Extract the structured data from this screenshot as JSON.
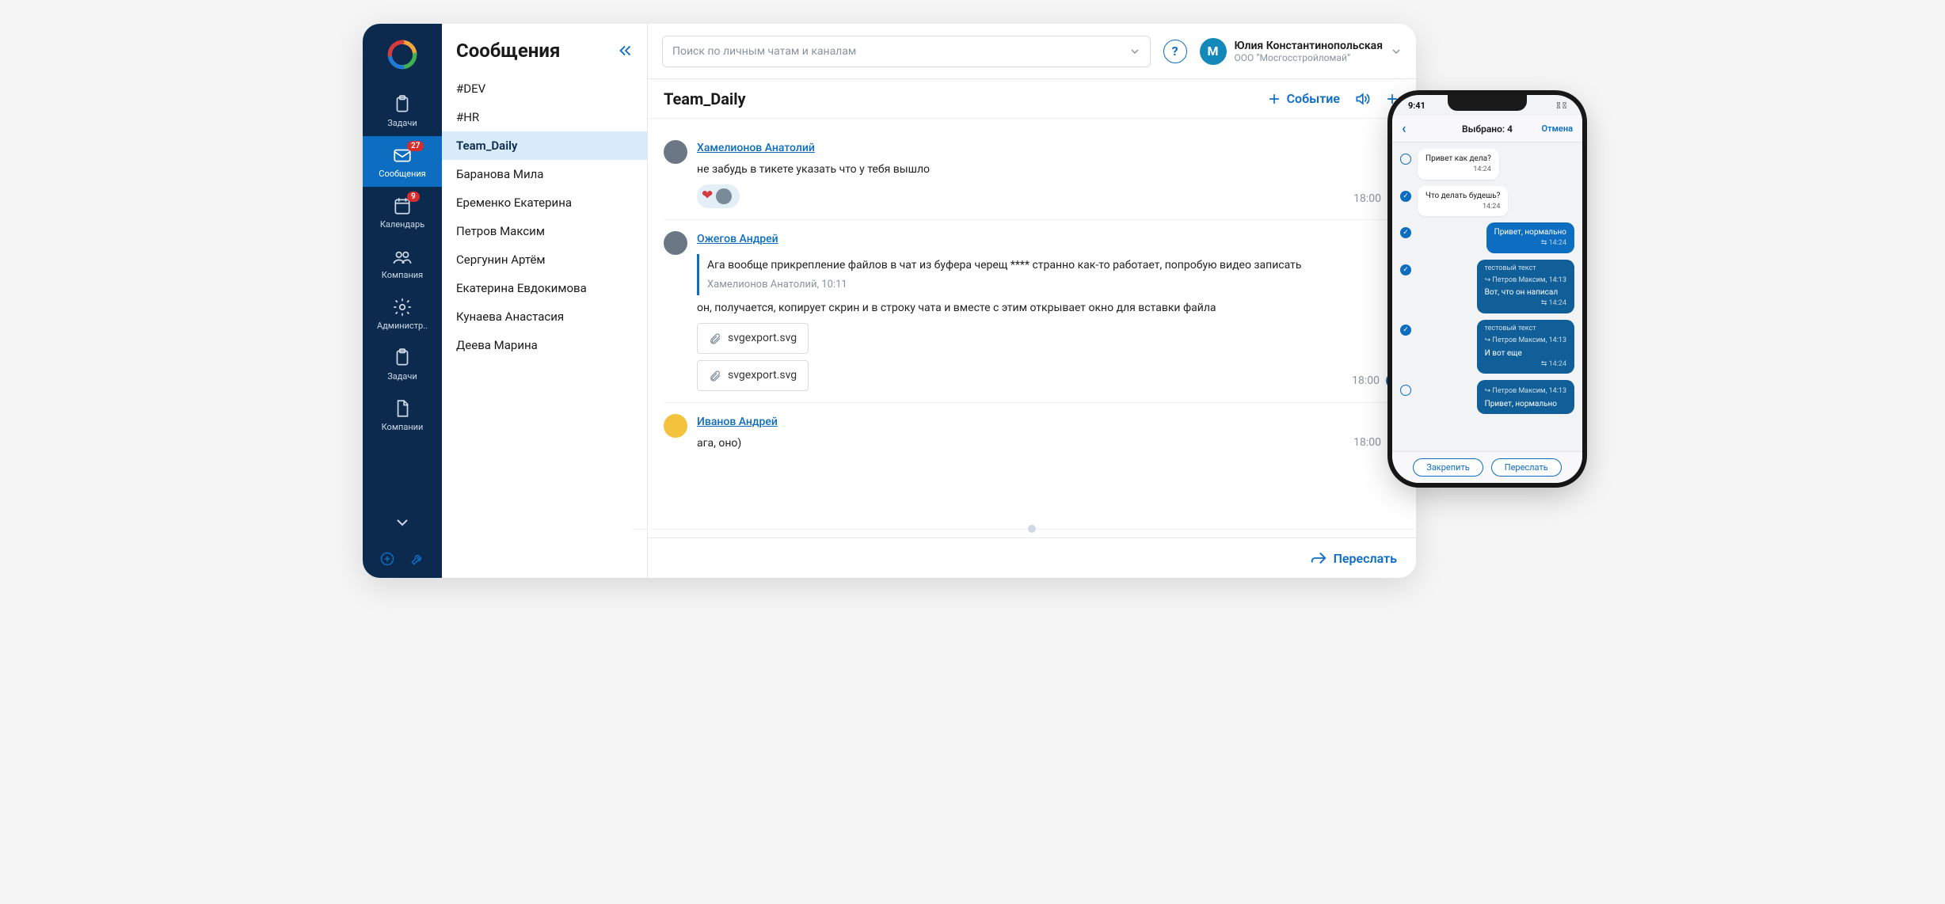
{
  "rail": {
    "items": [
      {
        "label": "Задачи",
        "badge": null
      },
      {
        "label": "Сообщения",
        "badge": "27"
      },
      {
        "label": "Календарь",
        "badge": "9"
      },
      {
        "label": "Компания",
        "badge": null
      },
      {
        "label": "Администр..",
        "badge": null
      },
      {
        "label": "Задачи",
        "badge": null
      },
      {
        "label": "Компании",
        "badge": null
      }
    ]
  },
  "channels": {
    "title": "Сообщения",
    "items": [
      "#DEV",
      "#HR",
      "Team_Daily",
      "Баранова Мила",
      "Еременко Екатерина",
      "Петров Максим",
      "Сергунин Артём",
      "Екатерина Евдокимова",
      "Кунаева Анастасия",
      "Деева Марина"
    ],
    "active": "Team_Daily"
  },
  "search": {
    "placeholder": "Поиск по личным чатам и каналам"
  },
  "user": {
    "initial": "М",
    "name": "Юлия Константинопольская",
    "org": "ООО “Мосгосстройломай”"
  },
  "chat": {
    "title": "Team_Daily",
    "actions": {
      "event": "Событие"
    },
    "forward": "Переслать",
    "messages": [
      {
        "author": "Хамелионов Анатолий",
        "text": "не забудь в тикете указать что у тебя вышло",
        "time": "18:00",
        "status": "unread",
        "reaction": true
      },
      {
        "author": "Ожегов Андрей",
        "quote": "Ага вообще прикрепление файлов в чат из буфера черещ **** странно как-то работает, попробую видео записать",
        "quoteMeta": "Хамелионов Анатолий, 10:11",
        "text": "он, получается, копирует скрин и в строку чата и вместе с этим открывает окно для вставки файла",
        "attachments": [
          "svgexport.svg",
          "svgexport.svg"
        ],
        "time": "18:00",
        "status": "read"
      },
      {
        "author": "Иванов Андрей",
        "text": "ага, оно)",
        "time": "18:00",
        "status": "unread",
        "avatarColor": "yellow"
      }
    ]
  },
  "phone": {
    "clock": "9:41",
    "title": "Выбрано: 4",
    "cancel": "Отмена",
    "footer": {
      "pin": "Закрепить",
      "forward": "Переслать"
    },
    "rows": [
      {
        "sel": false,
        "side": "in",
        "text": "Привет как дела?",
        "time": "14:24"
      },
      {
        "sel": true,
        "side": "in",
        "text": "Что делать будешь?",
        "time": "14:24"
      },
      {
        "sel": true,
        "side": "out",
        "text": "Привет, нормально",
        "time": "14:24"
      },
      {
        "sel": true,
        "side": "outdark",
        "text": "Вот, что он написал",
        "time": "14:24",
        "quoteTitle": "тестовый текст",
        "quoteMeta": "Петров Максим, 14:13"
      },
      {
        "sel": true,
        "side": "outdark",
        "text": "И вот еще",
        "time": "14:24",
        "quoteTitle": "тестовый текст",
        "quoteMeta": "Петров Максим, 14:13"
      },
      {
        "sel": false,
        "side": "outdark",
        "text": "Привет, нормально",
        "time": "",
        "quoteMeta": "Петров Максим, 14:13"
      }
    ]
  }
}
